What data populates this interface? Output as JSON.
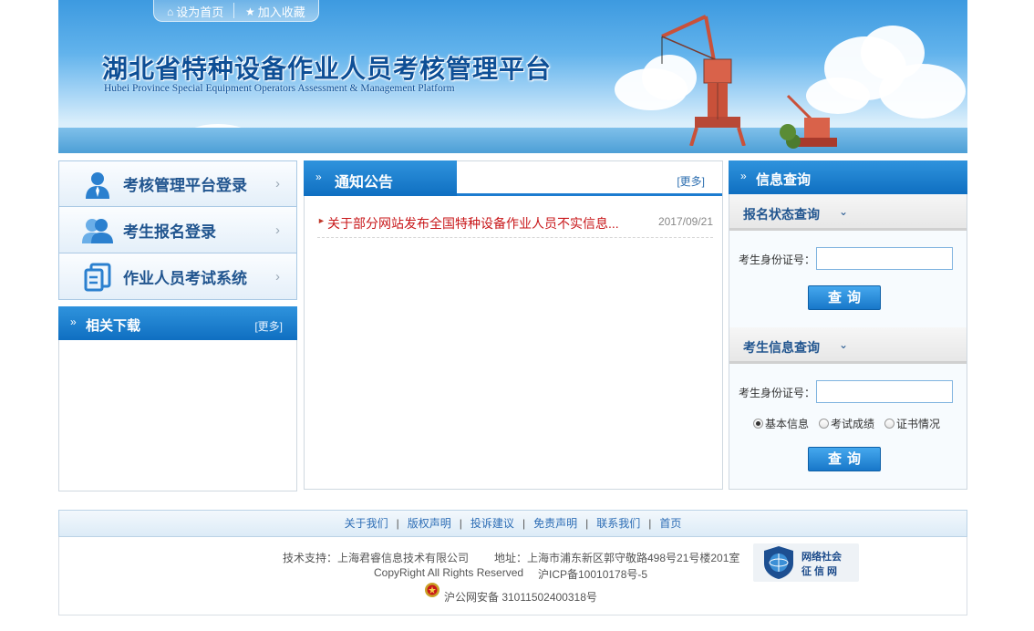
{
  "header": {
    "top_links": [
      {
        "label": "设为首页",
        "icon": "home-icon"
      },
      {
        "label": "加入收藏",
        "icon": "star-icon"
      }
    ],
    "title": "湖北省特种设备作业人员考核管理平台",
    "subtitle": "Hubei Province Special Equipment Operators Assessment & Management Platform"
  },
  "login_menu": [
    {
      "label": "考核管理平台登录",
      "icon": "admin-user-icon"
    },
    {
      "label": "考生报名登录",
      "icon": "users-icon"
    },
    {
      "label": "作业人员考试系统",
      "icon": "exam-document-icon"
    }
  ],
  "downloads": {
    "title": "相关下载",
    "more": "[更多]"
  },
  "notice": {
    "title": "通知公告",
    "more": "[更多]",
    "items": [
      {
        "title": "关于部分网站发布全国特种设备作业人员不实信息...",
        "date": "2017/09/21"
      }
    ]
  },
  "query": {
    "title": "信息查询",
    "registration": {
      "title": "报名状态查询",
      "id_label": "考生身份证号：",
      "id_value": "",
      "button": "查询"
    },
    "info": {
      "title": "考生信息查询",
      "id_label": "考生身份证号：",
      "id_value": "",
      "options": [
        {
          "label": "基本信息",
          "checked": true
        },
        {
          "label": "考试成绩",
          "checked": false
        },
        {
          "label": "证书情况",
          "checked": false
        }
      ],
      "button": "查询"
    }
  },
  "footer": {
    "links": [
      "关于我们",
      "版权声明",
      "投诉建议",
      "免责声明",
      "联系我们",
      "首页"
    ],
    "tech_support": "技术支持：上海君睿信息技术有限公司",
    "address": "地址：上海市浦东新区郭守敬路498号21号楼201室",
    "copyright": "CopyRight All Rights Reserved",
    "icp": "沪ICP备10010178号-5",
    "police": "沪公网安备 31011502400318号",
    "seal_line1": "网络社会",
    "seal_line2": "征信网"
  },
  "colors": {
    "primary_blue": "#0f6fc1",
    "link_blue": "#2d6db5",
    "notice_red": "#c8171a",
    "title_navy": "#0e4f96"
  }
}
